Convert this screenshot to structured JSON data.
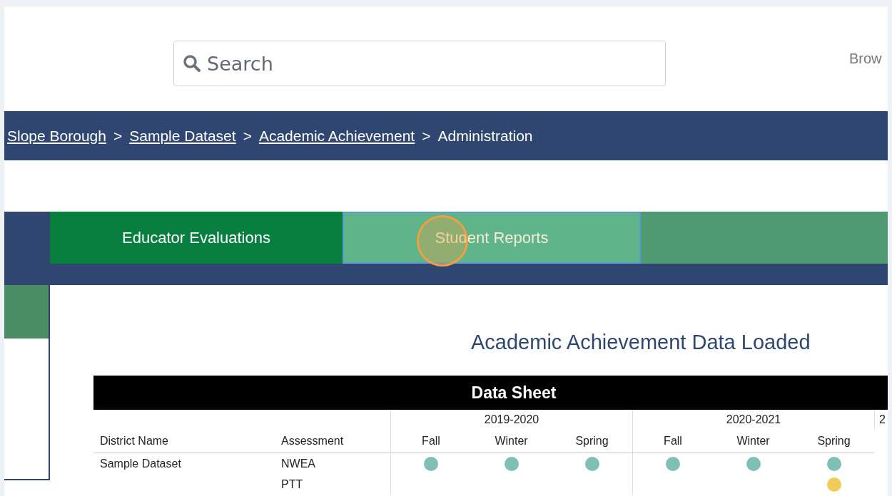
{
  "search": {
    "placeholder": "Search"
  },
  "header_link": "Brow",
  "breadcrumb": [
    {
      "label": "Slope Borough",
      "kind": "link"
    },
    {
      "label": ">",
      "kind": "separator"
    },
    {
      "label": "Sample Dataset",
      "kind": "link"
    },
    {
      "label": ">",
      "kind": "separator"
    },
    {
      "label": "Academic Achievement",
      "kind": "link"
    },
    {
      "label": ">",
      "kind": "separator"
    },
    {
      "label": "Administration",
      "kind": "current"
    }
  ],
  "tabs": [
    {
      "label": "Educator Evaluations",
      "selected": false
    },
    {
      "label": "Student Reports",
      "selected": true
    }
  ],
  "heading": "Academic Achievement Data Loaded",
  "table": {
    "title": "Data Sheet",
    "columns": [
      "District Name",
      "Assessment"
    ],
    "year_groups": [
      {
        "label": "2019-2020",
        "seasons": [
          "Fall",
          "Winter",
          "Spring"
        ]
      },
      {
        "label": "2020-2021",
        "seasons": [
          "Fall",
          "Winter",
          "Spring"
        ]
      }
    ],
    "column_9": "2",
    "rows": [
      {
        "district": "Sample Dataset",
        "assessment": "NWEA",
        "cells": [
          {
            "color": "#7fbfb5"
          },
          {
            "color": "#7fbfb5"
          },
          {
            "color": "#7fbfb5"
          },
          {
            "color": "#7fbfb5"
          },
          {
            "color": "#7fbfb5"
          },
          {
            "color": "#7fbfb5"
          }
        ]
      },
      {
        "assessment": "PTT",
        "cells": [
          {},
          {},
          {},
          {},
          {},
          {
            "color": "#f2cc5a"
          }
        ]
      }
    ]
  }
}
